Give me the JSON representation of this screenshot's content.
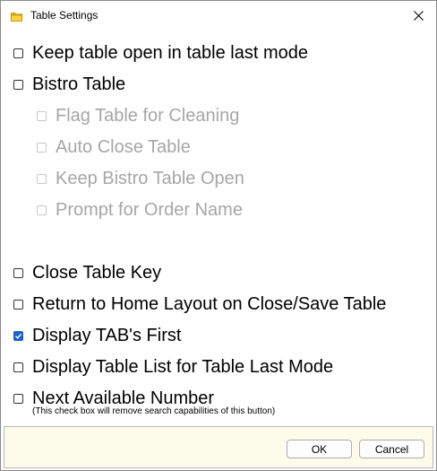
{
  "window": {
    "title": "Table Settings"
  },
  "options": [
    {
      "label": "Keep table open in table last mode",
      "checked": false,
      "disabled": false
    },
    {
      "label": "Bistro Table",
      "checked": false,
      "disabled": false
    },
    {
      "label": "Flag Table for Cleaning",
      "checked": false,
      "disabled": true
    },
    {
      "label": "Auto Close Table",
      "checked": false,
      "disabled": true
    },
    {
      "label": "Keep Bistro Table Open",
      "checked": false,
      "disabled": true
    },
    {
      "label": "Prompt for Order Name",
      "checked": false,
      "disabled": true
    },
    {
      "label": "Close Table Key",
      "checked": false,
      "disabled": false
    },
    {
      "label": "Return to Home Layout on Close/Save Table",
      "checked": false,
      "disabled": false
    },
    {
      "label": "Display TAB's First",
      "checked": true,
      "disabled": false
    },
    {
      "label": "Display Table List for Table Last Mode",
      "checked": false,
      "disabled": false
    },
    {
      "label": "Next Available Number",
      "checked": false,
      "disabled": false
    }
  ],
  "next_available_note": "(This check box will remove search capabilities of this button)",
  "buttons": {
    "ok": "OK",
    "cancel": "Cancel"
  },
  "colors": {
    "accent": "#1a62c9",
    "footer_bg": "#fdfbe9",
    "disabled_text": "#a6a6a6"
  },
  "icons": {
    "app": "folder-icon",
    "close": "close-icon",
    "check": "checkmark-icon"
  }
}
